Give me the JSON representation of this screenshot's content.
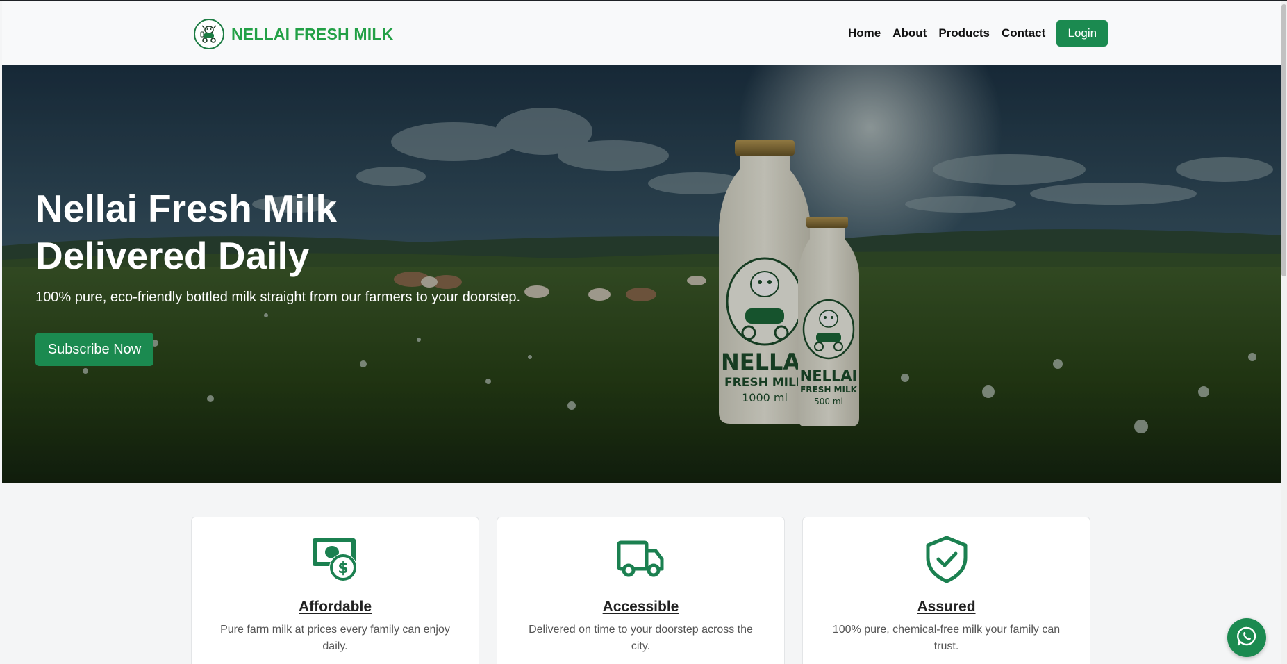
{
  "header": {
    "brand_name": "NELLAI FRESH MILK",
    "nav": [
      {
        "label": "Home"
      },
      {
        "label": "About"
      },
      {
        "label": "Products"
      },
      {
        "label": "Contact"
      }
    ],
    "login_label": "Login"
  },
  "hero": {
    "title_line1": "Nellai Fresh Milk",
    "title_line2": "Delivered Daily",
    "subtitle": "100% pure, eco-friendly bottled milk straight from our farmers to your doorstep.",
    "cta_label": "Subscribe Now",
    "bottle_large": {
      "brand": "NELLAI",
      "product": "FRESH MILK",
      "volume": "1000 ml"
    },
    "bottle_small": {
      "brand": "NELLAI",
      "product": "FRESH MILK",
      "volume": "500 ml"
    }
  },
  "features": [
    {
      "icon": "money-icon",
      "title": "Affordable",
      "desc": "Pure farm milk at prices every family can enjoy daily."
    },
    {
      "icon": "truck-icon",
      "title": "Accessible",
      "desc": "Delivered on time to your doorstep across the city."
    },
    {
      "icon": "shield-check-icon",
      "title": "Assured",
      "desc": "100% pure, chemical-free milk your family can trust."
    }
  ],
  "floating": {
    "icon": "whatsapp-icon"
  },
  "colors": {
    "brand_green": "#22a046",
    "button_green": "#1b8a50",
    "icon_green": "#1b8050"
  }
}
